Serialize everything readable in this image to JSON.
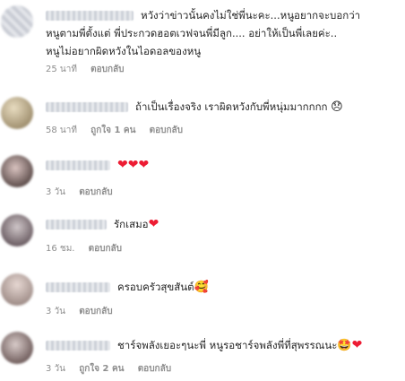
{
  "comments": [
    {
      "lines": [
        "หวังว่าข่าวนั้นคงไม่ใช่พี่นะคะ...หนูอยากจะบอกว่า",
        "หนูตามพี่ตั้งแต่ พี่ประกวดฮอตเวฟจนพี่มีลูก.... อย่าให้เป็นพี่เลยค่ะ..",
        "หนูไม่อยากผิดหวังในไอดอลของหนู"
      ],
      "time": "25 นาที",
      "likes": "",
      "reply": "ตอบกลับ",
      "emojis": ""
    },
    {
      "lines": [
        "ถ้าเป็นเรื่องจริง เราผิดหวังกับพี่หนุ่มมากกกก"
      ],
      "time": "58 นาที",
      "likes": "ถูกใจ 1 คน",
      "reply": "ตอบกลับ",
      "emojis": "😞"
    },
    {
      "lines": [
        ""
      ],
      "time": "3 วัน",
      "likes": "",
      "reply": "ตอบกลับ",
      "emojis": "❤❤❤"
    },
    {
      "lines": [
        "รักเสมอ"
      ],
      "time": "16 ชม.",
      "likes": "",
      "reply": "ตอบกลับ",
      "emojis": "❤"
    },
    {
      "lines": [
        "ครอบครัวสุขสันต์"
      ],
      "time": "3 วัน",
      "likes": "",
      "reply": "ตอบกลับ",
      "emojis": "🥰"
    },
    {
      "lines": [
        "ชาร์จพลังเยอะๆนะพี่ หนูรอชาร์จพลังพี่ที่สุพรรณนะ"
      ],
      "time": "3 วัน",
      "likes": "ถูกใจ 2 คน",
      "reply": "ตอบกลับ",
      "emojis": "🤩❤"
    }
  ],
  "colors": {
    "heart": "#ed1c33",
    "meta": "#8e8e8e",
    "text": "#262626"
  }
}
